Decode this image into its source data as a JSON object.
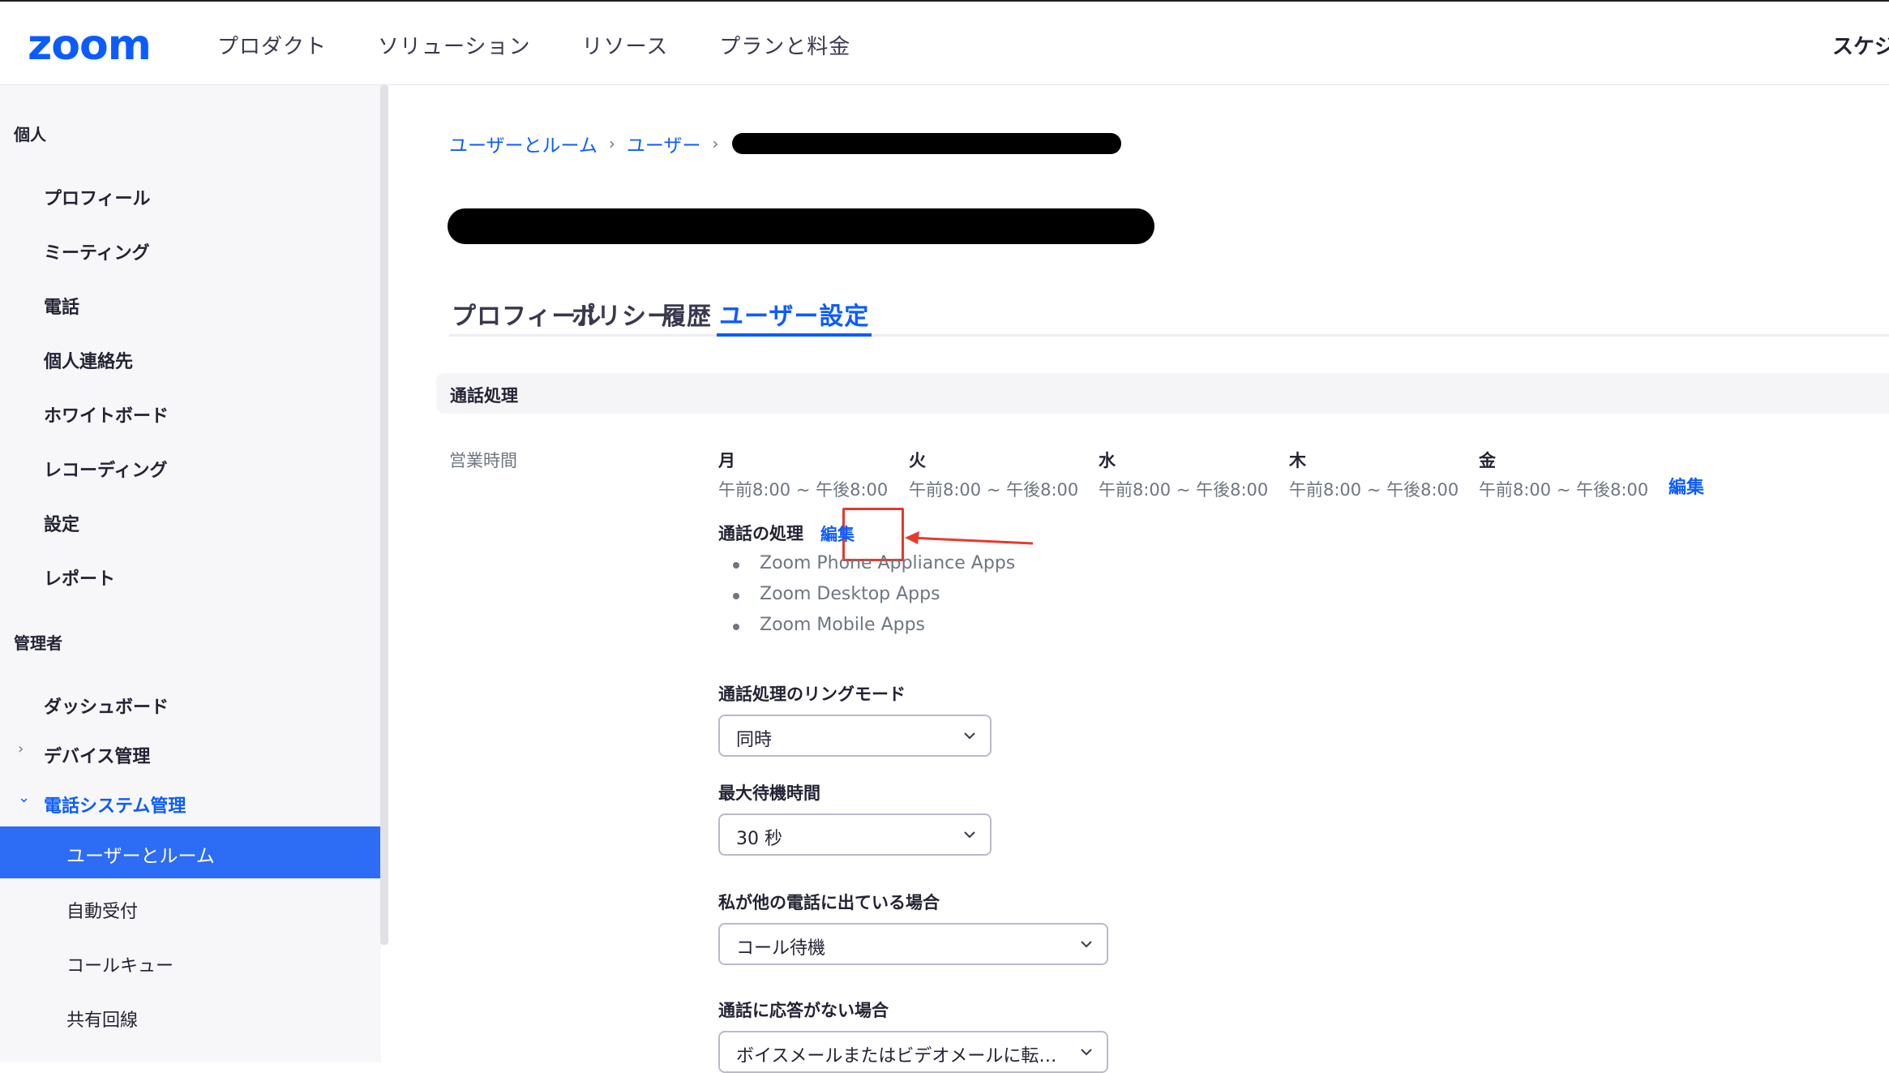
{
  "header": {
    "logo": "zoom",
    "nav": [
      "プロダクト",
      "ソリューション",
      "リソース",
      "プランと料金"
    ],
    "right_item": "スケジ"
  },
  "sidebar": {
    "personal_heading": "個人",
    "personal_items": [
      "プロフィール",
      "ミーティング",
      "電話",
      "個人連絡先",
      "ホワイトボード",
      "レコーディング",
      "設定",
      "レポート"
    ],
    "admin_heading": "管理者",
    "dashboard": "ダッシュボード",
    "device_mgmt": "デバイス管理",
    "phone_system": "電話システム管理",
    "active_item": "ユーザーとルーム",
    "sub_items": [
      "自動受付",
      "コールキュー",
      "共有回線"
    ]
  },
  "breadcrumb": [
    "ユーザーとルーム",
    "ユーザー"
  ],
  "tabs": [
    "プロフィール",
    "ポリシー",
    "履歴",
    "ユーザー設定"
  ],
  "active_tab": "ユーザー設定",
  "section_title": "通話処理",
  "business_hours": {
    "label": "営業時間",
    "days": [
      {
        "name": "月",
        "time": "午前8:00 ~ 午後8:00"
      },
      {
        "name": "火",
        "time": "午前8:00 ~ 午後8:00"
      },
      {
        "name": "水",
        "time": "午前8:00 ~ 午後8:00"
      },
      {
        "name": "木",
        "time": "午前8:00 ~ 午後8:00"
      },
      {
        "name": "金",
        "time": "午前8:00 ~ 午後8:00"
      }
    ],
    "edit": "編集"
  },
  "call_handling": {
    "label": "通話の処理",
    "edit": "編集",
    "apps": [
      "Zoom Phone Appliance Apps",
      "Zoom Desktop Apps",
      "Zoom Mobile Apps"
    ]
  },
  "ring_mode": {
    "label": "通話処理のリングモード",
    "value": "同時"
  },
  "max_wait": {
    "label": "最大待機時間",
    "value": "30 秒"
  },
  "on_other_call": {
    "label": "私が他の電話に出ている場合",
    "value": "コール待機"
  },
  "no_answer": {
    "label": "通話に応答がない場合",
    "value": "ボイスメールまたはビデオメールに転…"
  },
  "colors": {
    "accent": "#0b5cff",
    "active_sidebar": "#2d6cf5",
    "highlight": "#e8392b"
  }
}
